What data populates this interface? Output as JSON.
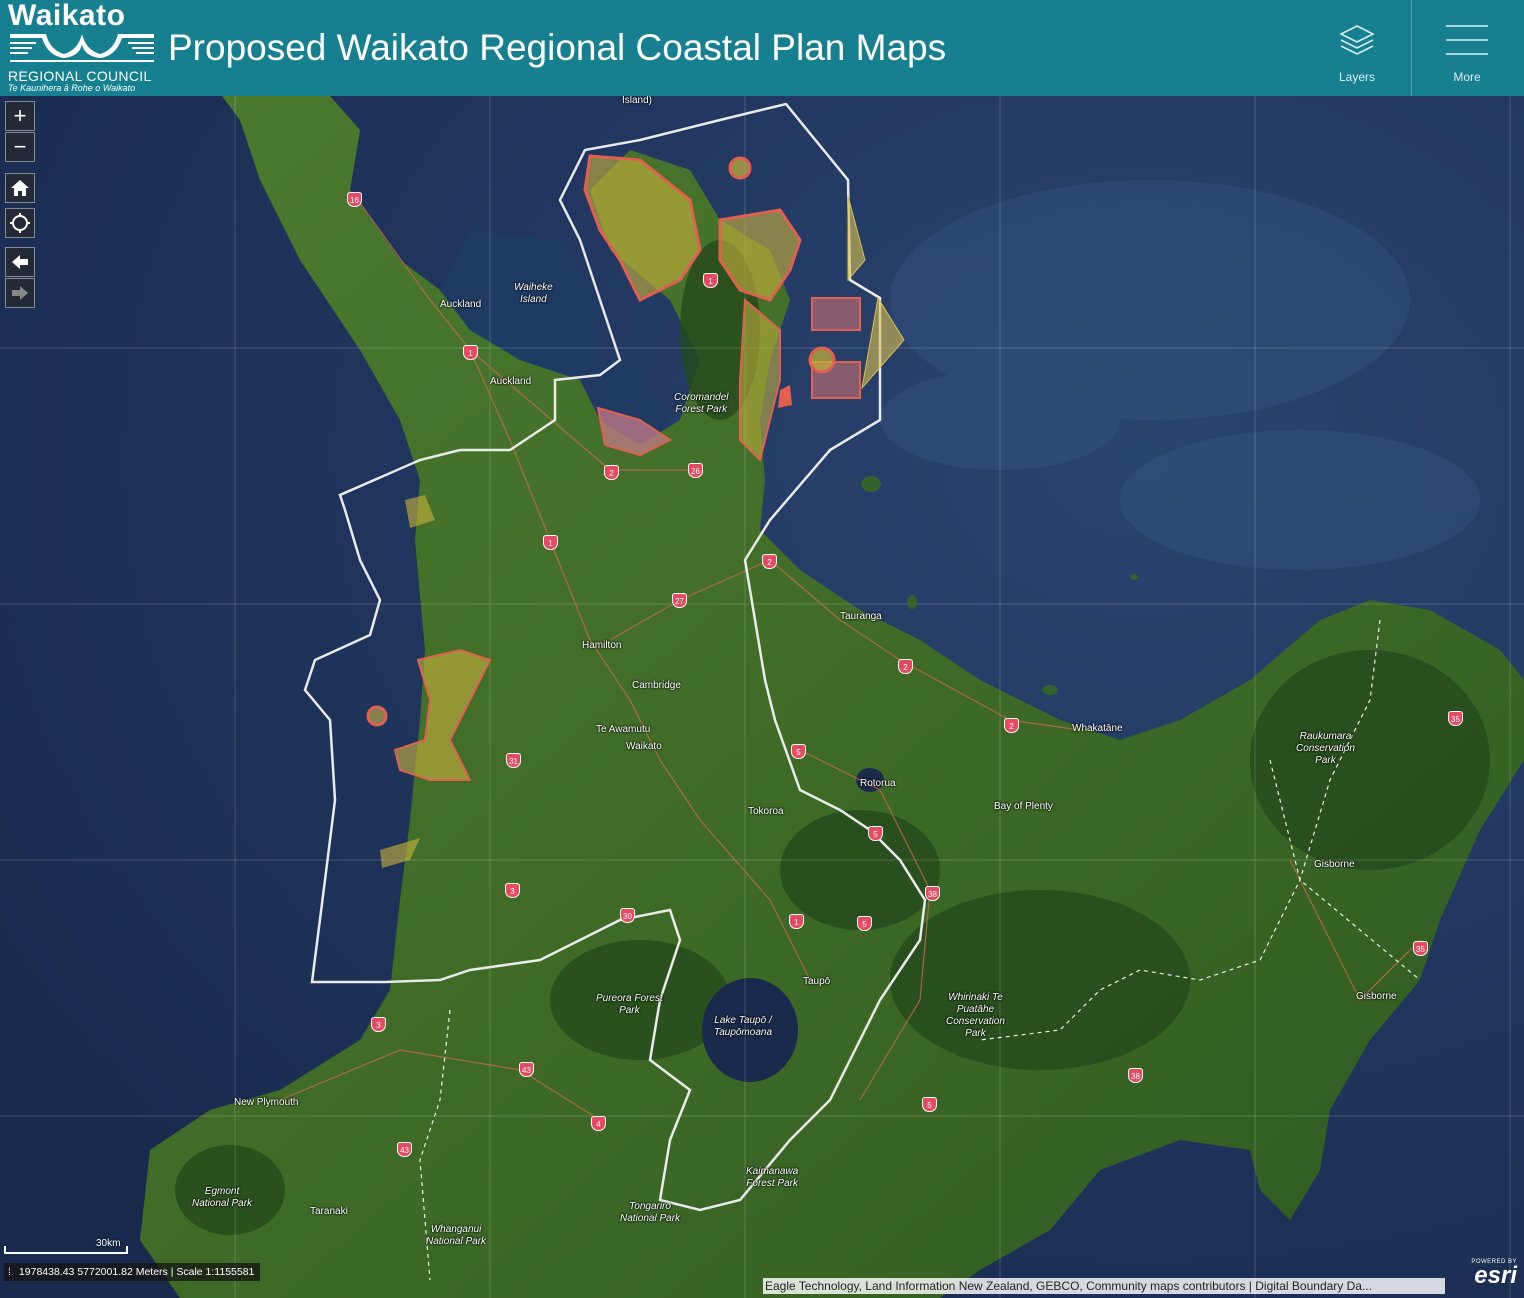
{
  "header": {
    "logo": {
      "name": "Waikato",
      "org": "REGIONAL COUNCIL",
      "maori": "Te Kaunihera ā Rohe o Waikato"
    },
    "title": "Proposed Waikato Regional Coastal Plan Maps",
    "buttons": {
      "layers": "Layers",
      "more": "More"
    },
    "icons": {
      "layers": "layers-icon",
      "more": "hamburger-menu-icon"
    },
    "colors": {
      "header": "#167f90",
      "boundary": "#e8e8e8",
      "coastal_zone": "#c9b43c",
      "hazard": "#e2604f",
      "highway_shield": "#e64a62"
    }
  },
  "map_controls": {
    "zoom_in": "+",
    "zoom_out": "−",
    "icons": [
      "zoom-in-icon",
      "zoom-out-icon",
      "home-icon",
      "locate-icon",
      "back-arrow-icon",
      "forward-arrow-icon"
    ]
  },
  "places": {
    "island": "Island)",
    "waiheke": "Waiheke\nIsland",
    "auckland1": "Auckland",
    "auckland2": "Auckland",
    "coromandel": "Coromandel\nForest Park",
    "tauranga": "Tauranga",
    "hamilton": "Hamilton",
    "cambridge": "Cambridge",
    "teawamutu": "Te Awamutu",
    "waikato": "Waikato",
    "whakatane": "Whakatāne",
    "raukumara": "Raukumara\nConservation\nPark",
    "rotorua": "Rotorua",
    "bop": "Bay of Plenty",
    "tokoroa": "Tokoroa",
    "gisborne1": "Gisborne",
    "taupo": "Taupō",
    "whirinaki": "Whirinaki Te\nPuatāhe\nConservation\nPark",
    "gisborne2": "Gisborne",
    "pureora": "Pureora Forest\nPark",
    "laketaupo": "Lake Taupō /\nTaupōmoana",
    "newplymouth": "New Plymouth",
    "kaimanawa": "Kaimanawa\nForest Park",
    "egmont": "Egmont\nNational Park",
    "taranaki": "Taranaki",
    "tongariro": "Tongariro\nNational Park",
    "whanganui": "Whanganui\nNational Park"
  },
  "highway_shields": [
    "16",
    "1",
    "1",
    "2",
    "26",
    "1",
    "2",
    "27",
    "2",
    "2",
    "35",
    "31",
    "5",
    "5",
    "38",
    "3",
    "30",
    "1",
    "5",
    "35",
    "3",
    "43",
    "4",
    "43",
    "38",
    "5"
  ],
  "scale": {
    "bar_label": "30km",
    "coordinates": "1978438.43 5772001.82 Meters | Scale 1:1155581"
  },
  "attribution": "Eagle Technology, Land Information New Zealand, GEBCO, Community maps contributors | Digital Boundary Da...",
  "esri": {
    "powered_by": "POWERED BY",
    "brand": "esri"
  }
}
